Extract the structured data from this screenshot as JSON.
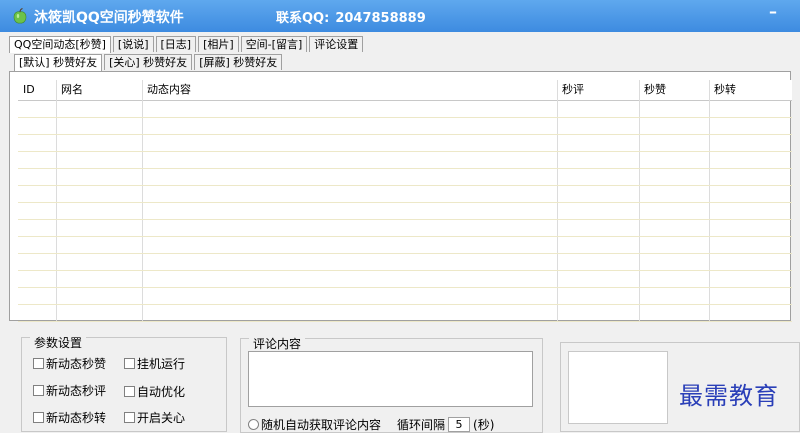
{
  "window": {
    "title": "沐筱凯QQ空间秒赞软件",
    "contact_label": "联系QQ:",
    "contact_value": "2047858889",
    "minimize_label": "–",
    "icon": "apple-icon"
  },
  "tabs_main": [
    {
      "label": "QQ空间动态[秒赞]",
      "active": true
    },
    {
      "label": "[说说]",
      "active": false
    },
    {
      "label": "[日志]",
      "active": false
    },
    {
      "label": "[相片]",
      "active": false
    },
    {
      "label": "空间-[留言]",
      "active": false
    },
    {
      "label": "评论设置",
      "active": false
    }
  ],
  "tabs_sub": [
    {
      "label": "[默认] 秒赞好友",
      "active": true
    },
    {
      "label": "[关心] 秒赞好友",
      "active": false
    },
    {
      "label": "[屏蔽] 秒赞好友",
      "active": false
    }
  ],
  "table": {
    "columns": [
      "ID",
      "网名",
      "动态内容",
      "秒评",
      "秒赞",
      "秒转"
    ]
  },
  "params": {
    "title": "参数设置",
    "options": [
      {
        "label": "新动态秒赞",
        "checked": false
      },
      {
        "label": "挂机运行",
        "checked": false
      },
      {
        "label": "新动态秒评",
        "checked": false
      },
      {
        "label": "自动优化",
        "checked": false
      },
      {
        "label": "新动态秒转",
        "checked": false
      },
      {
        "label": "开启关心",
        "checked": false
      }
    ]
  },
  "comment": {
    "title": "评论内容",
    "textarea_value": "",
    "random_label": "随机自动获取评论内容",
    "interval_label": "循环间隔",
    "interval_value": "5",
    "interval_unit": "(秒)"
  },
  "watermark": "最需教育",
  "colors": {
    "titlebar": "#3d8be0",
    "watermark": "#2a3fb8"
  }
}
